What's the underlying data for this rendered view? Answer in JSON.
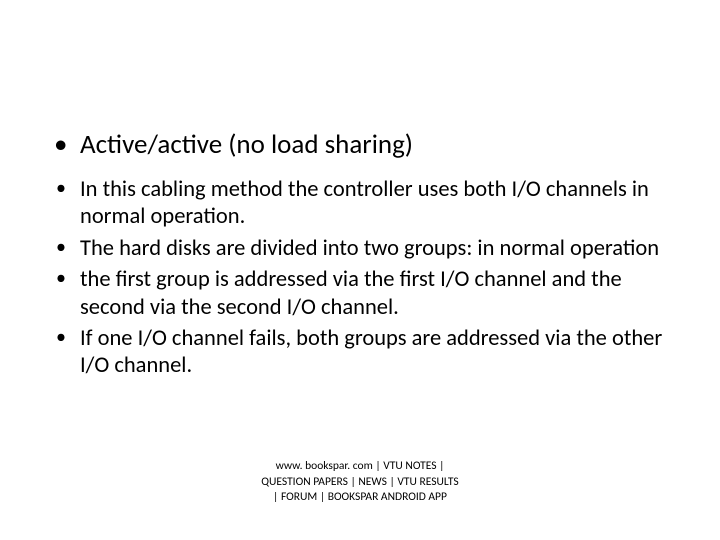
{
  "main_bullet": "Active/active (no load sharing)",
  "sub_bullets": [
    "In this cabling method the controller uses both I/O channels in normal operation.",
    "The hard disks are divided into two groups: in normal operation",
    "the first group is addressed via the first I/O channel and the second via the second I/O channel.",
    " If one I/O channel fails, both groups are addressed via the other I/O channel."
  ],
  "footer_lines": [
    "www. bookspar. com | VTU NOTES |",
    "QUESTION PAPERS | NEWS | VTU RESULTS",
    "| FORUM | BOOKSPAR ANDROID APP"
  ]
}
